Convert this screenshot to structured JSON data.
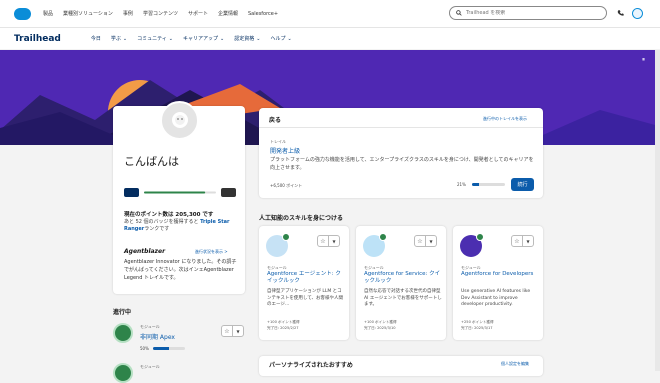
{
  "topnav": {
    "links": [
      "製品",
      "業種別ソリューション",
      "事例",
      "学習コンテンツ",
      "サポート",
      "企業情報",
      "Salesforce+"
    ],
    "search_placeholder": "Trailhead を検索"
  },
  "nav": {
    "brand": "Trailhead",
    "items": [
      {
        "label": "今日",
        "chevron": false
      },
      {
        "label": "学ぶ",
        "chevron": true
      },
      {
        "label": "コミュニティ",
        "chevron": true
      },
      {
        "label": "キャリアアップ",
        "chevron": true
      },
      {
        "label": "認定資格",
        "chevron": true
      },
      {
        "label": "ヘルプ",
        "chevron": true
      }
    ]
  },
  "profile": {
    "greeting": "こんばんは",
    "points_text": "現在のポイント数は 205,300 です",
    "points_sub": "あと 52 個のバッジを獲得すると",
    "points_link": "Triple Star Ranger",
    "points_sub2": "ランクです",
    "rank_progress": 0.85,
    "agentblazer_title": "Agentblazer",
    "agentblazer_link": "進行状況を表示 >",
    "agentblazer_body": "Agentblazer Innovator になりました。その調子でがんばってください。次はインェAgentblazer Legend トレイルです。"
  },
  "in_progress": {
    "title": "進行中",
    "items": [
      {
        "label": "モジュール",
        "name": "非同期 Apex",
        "progress_text": "50%",
        "progress": 0.5
      },
      {
        "label": "モジュール"
      }
    ]
  },
  "back": {
    "title": "戻る",
    "link": "進行中のトレイルを表示",
    "trail_label": "トレイル",
    "trail_name": "開発者上級",
    "trail_desc": "プラットフォームの強力な機能を活用して、エンタープライズクラスのスキルを身につけ、開発者としてのキャリアを向上させます。",
    "points": "+6,500 ポイント",
    "pct_text": "21%",
    "progress": 0.21,
    "button": "続行"
  },
  "ai": {
    "title": "人工知能のスキルを身につける",
    "modules": [
      {
        "label": "モジュール",
        "title": "Agentforce エージェント: クイックルック",
        "desc": "自律型アプリケーションが LLM とコンテキストを使用して、お客様や人間のエージ…",
        "points": "+100 ポイント獲得",
        "date": "完了日: 2025/2/27"
      },
      {
        "label": "モジュール",
        "title": "Agentforce for Service: クイックルック",
        "desc": "自然な応答で対話する次世代の自律型 AI エージェントでお客様をサポートします。",
        "points": "+100 ポイント獲得",
        "date": "完了日: 2025/3/10"
      },
      {
        "label": "モジュール",
        "title": "Agentforce for Developers",
        "desc": "Use generative AI features like Dev Assistant to improve developer productivity.",
        "points": "+250 ポイント獲得",
        "date": "完了日: 2025/3/17"
      }
    ]
  },
  "recommend": {
    "title": "パーソナライズされたおすすめ",
    "link": "個人設定を編集"
  },
  "colors": {
    "accent": "#0b5cab",
    "banner": "#4f28b3",
    "success": "#2e844a"
  }
}
